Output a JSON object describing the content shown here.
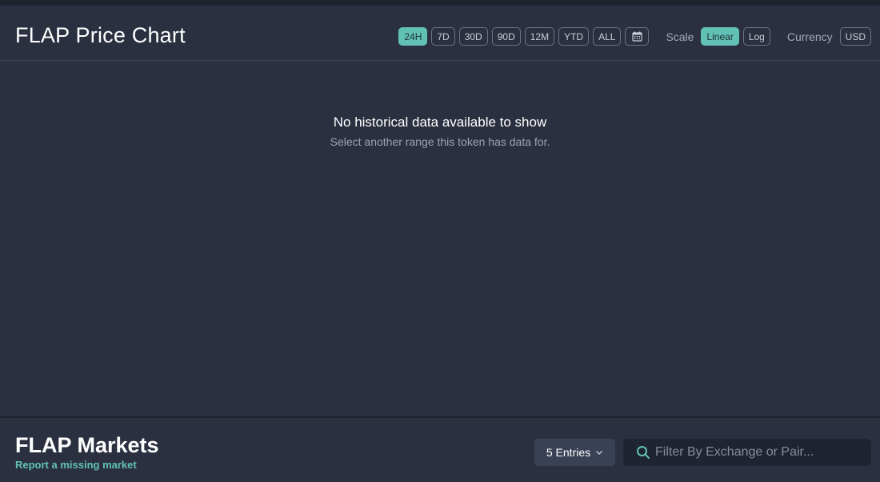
{
  "chart": {
    "title": "FLAP Price Chart",
    "ranges": [
      {
        "label": "24H",
        "active": true
      },
      {
        "label": "7D",
        "active": false
      },
      {
        "label": "30D",
        "active": false
      },
      {
        "label": "90D",
        "active": false
      },
      {
        "label": "12M",
        "active": false
      },
      {
        "label": "YTD",
        "active": false
      },
      {
        "label": "ALL",
        "active": false
      }
    ],
    "calendar_icon": "calendar-icon",
    "scale_label": "Scale",
    "scale_options": [
      {
        "label": "Linear",
        "active": true
      },
      {
        "label": "Log",
        "active": false
      }
    ],
    "currency_label": "Currency",
    "currency_value": "USD",
    "empty_title": "No historical data available to show",
    "empty_subtitle": "Select another range this token has data for."
  },
  "markets": {
    "title": "FLAP Markets",
    "report_link": "Report a missing market",
    "entries_label": "5 Entries",
    "entries_icon": "chevron-down-icon",
    "search_icon": "search-icon",
    "search_placeholder": "Filter By Exchange or Pair...",
    "search_value": ""
  },
  "colors": {
    "background": "#2b3040",
    "accent": "#61c1b6",
    "search_bg": "#1f2431",
    "entries_bg": "#3a4155"
  }
}
